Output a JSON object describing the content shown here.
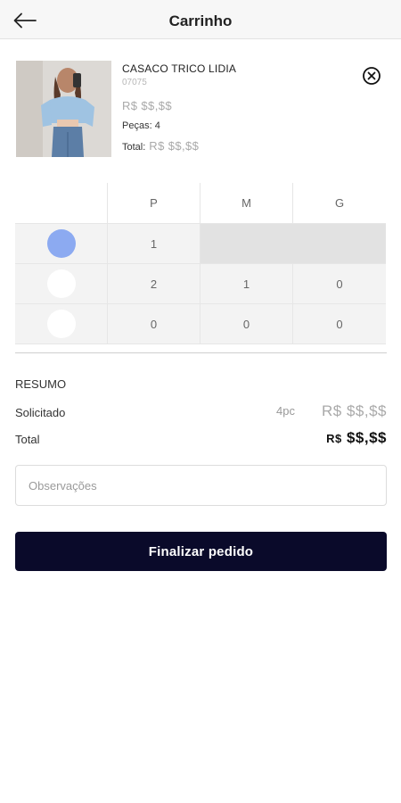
{
  "header": {
    "title": "Carrinho",
    "back_icon": "arrow-left-icon"
  },
  "product": {
    "name": "CASACO TRICO LIDIA",
    "code": "07075",
    "price": "R$ $$,$$",
    "pieces_label": "Peças:",
    "pieces_value": "4",
    "total_label": "Total:",
    "total_value": "R$ $$,$$",
    "remove_icon": "close-circle-icon"
  },
  "size_grid": {
    "sizes": [
      "P",
      "M",
      "G"
    ],
    "rows": [
      {
        "color": "#8caaf1",
        "selected": true,
        "quantities": [
          "1"
        ]
      },
      {
        "color": "#ffffff",
        "selected": false,
        "quantities": [
          "2",
          "1",
          "0"
        ]
      },
      {
        "color": "#ffffff",
        "selected": false,
        "quantities": [
          "0",
          "0",
          "0"
        ]
      }
    ]
  },
  "summary": {
    "title": "RESUMO",
    "requested_label": "Solicitado",
    "requested_pieces": "4pc",
    "requested_amount": "R$ $$,$$",
    "total_label": "Total",
    "total_currency": "R$",
    "total_amount": "$$,$$"
  },
  "notes": {
    "placeholder": "Observações",
    "value": ""
  },
  "actions": {
    "finish_label": "Finalizar pedido"
  },
  "colors": {
    "button_bg": "#0a0a2a",
    "swatch_selected": "#8caaf1"
  }
}
